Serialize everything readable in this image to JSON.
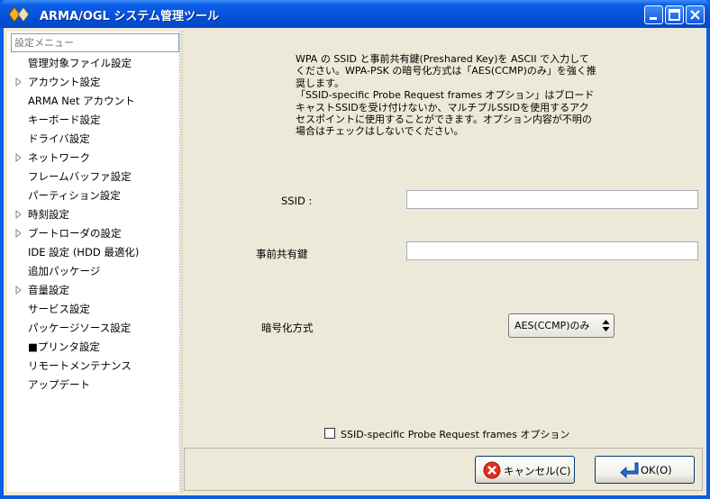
{
  "window": {
    "title": "ARMA/OGL システム管理ツール"
  },
  "sidebar": {
    "search_placeholder": "設定メニュー",
    "items": [
      {
        "label": "管理対象ファイル設定",
        "expandable": false
      },
      {
        "label": "アカウント設定",
        "expandable": true
      },
      {
        "label": "ARMA Net アカウント",
        "expandable": false
      },
      {
        "label": "キーボード設定",
        "expandable": false
      },
      {
        "label": "ドライバ設定",
        "expandable": false
      },
      {
        "label": "ネットワーク",
        "expandable": true
      },
      {
        "label": "フレームバッファ設定",
        "expandable": false
      },
      {
        "label": "パーティション設定",
        "expandable": false
      },
      {
        "label": "時刻設定",
        "expandable": true
      },
      {
        "label": "ブートローダの設定",
        "expandable": true
      },
      {
        "label": "IDE 設定 (HDD 最適化)",
        "expandable": false
      },
      {
        "label": "追加パッケージ",
        "expandable": false
      },
      {
        "label": "音量設定",
        "expandable": true
      },
      {
        "label": "サービス設定",
        "expandable": false
      },
      {
        "label": "パッケージソース設定",
        "expandable": false
      },
      {
        "label": "■プリンタ設定",
        "expandable": false
      },
      {
        "label": "リモートメンテナンス",
        "expandable": false
      },
      {
        "label": "アップデート",
        "expandable": false
      }
    ]
  },
  "content": {
    "description_lines": [
      "WPA の SSID と事前共有鍵(Preshared Key)を ASCII で入力して",
      "ください。WPA-PSK の暗号化方式は「AES(CCMP)のみ」を強く推",
      "奨します。",
      "「SSID-specific Probe Request frames オプション」はブロード",
      "キャストSSIDを受け付けないか、マルチプルSSIDを使用するアク",
      "セスポイントに使用することができます。オプション内容が不明の",
      "場合はチェックはしないでください。"
    ],
    "ssid_label": "SSID :",
    "ssid_value": "",
    "psk_label": "事前共有鍵",
    "psk_value": "",
    "encryption_label": "暗号化方式",
    "encryption_value": "AES(CCMP)のみ",
    "probe_option_label": "SSID-specific Probe Request frames オプション",
    "probe_option_checked": false
  },
  "buttons": {
    "cancel_label": "キャンセル(C)",
    "ok_label": "OK(O)"
  },
  "colors": {
    "titlebar": "#0450d8",
    "window_bg": "#ece9d8",
    "cancel_icon": "#e0301e",
    "ok_icon": "#2a6ad4"
  }
}
